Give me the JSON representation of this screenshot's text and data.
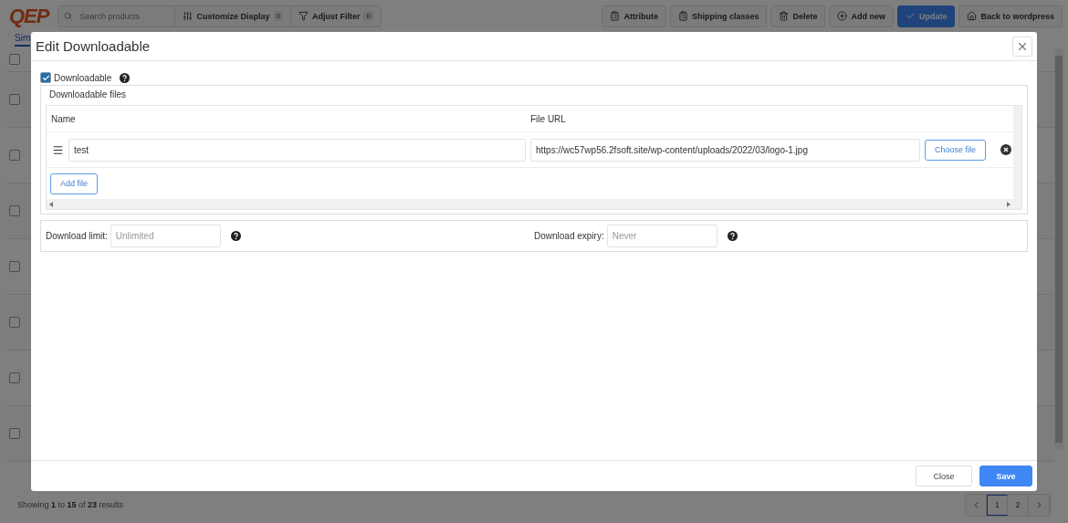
{
  "toolbar": {
    "logo": "QEP",
    "search": {
      "placeholder": "Search products"
    },
    "tools": [
      {
        "kind": "customize",
        "label": "Customize Display",
        "count": "0"
      },
      {
        "kind": "filter",
        "label": "Adjust Filter",
        "count": "0"
      }
    ],
    "actions": [
      {
        "kind": "attribute",
        "label": "Attribute"
      },
      {
        "kind": "shipping",
        "label": "Shipping classes"
      },
      {
        "kind": "delete",
        "label": "Delete"
      },
      {
        "kind": "add",
        "label": "Add new"
      },
      {
        "kind": "update",
        "label": "Update"
      },
      {
        "kind": "home",
        "label": "Back to wordpress"
      }
    ]
  },
  "tabs": [
    {
      "label": "Sim",
      "selected": true
    }
  ],
  "rows": [
    {
      "checked": false
    },
    {
      "checked": false
    },
    {
      "checked": false
    },
    {
      "checked": false
    },
    {
      "checked": false
    },
    {
      "checked": false
    },
    {
      "checked": false
    },
    {
      "checked": false
    }
  ],
  "footer": {
    "summary": "Showing **1** to **15** of **23** results",
    "pages": [
      {
        "label": "1",
        "selected": true
      },
      {
        "label": "2",
        "selected": false
      }
    ]
  },
  "modal": {
    "title": "Edit Downloadable",
    "downloadable": {
      "label": "Downloadable",
      "checked": true
    },
    "files": {
      "legend": "Downloadable files",
      "columns": [
        "Name",
        "File URL"
      ],
      "rows": [
        {
          "name": "test",
          "url": "https://wc57wp56.2fsoft.site/wp-content/uploads/2022/03/logo-1.jpg",
          "choose_label": "Choose file"
        }
      ],
      "add_label": "Add file"
    },
    "limit": {
      "label": "Download limit:",
      "placeholder": "Unlimited"
    },
    "expiry": {
      "label": "Download expiry:",
      "placeholder": "Never"
    },
    "buttons": [
      {
        "kind": "close",
        "label": "Close"
      },
      {
        "kind": "save",
        "label": "Save"
      }
    ]
  }
}
